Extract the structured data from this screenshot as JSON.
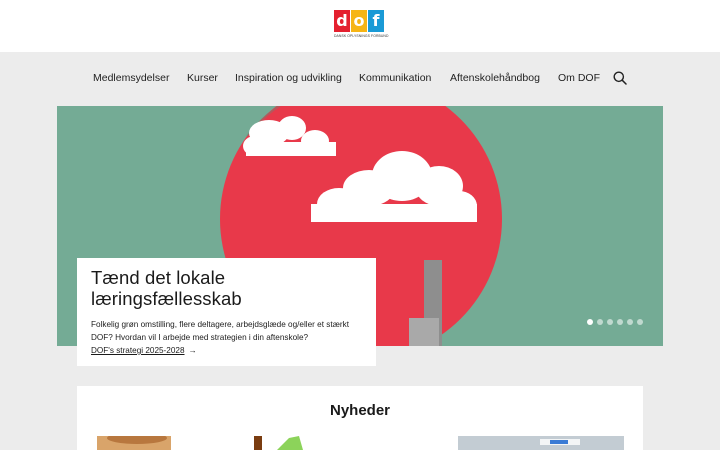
{
  "logo": {
    "letters": [
      "d",
      "o",
      "f"
    ],
    "letter_colors": [
      "#e4202f",
      "#f6b515",
      "#1a9ad6"
    ],
    "tagline": "DANSK OPLYSNINGS FORBUND"
  },
  "nav": {
    "items": [
      "Medlemsydelser",
      "Kurser",
      "Inspiration og udvikling",
      "Kommunikation",
      "Aftenskolehåndbog",
      "Om DOF"
    ],
    "search_icon": "search-icon"
  },
  "hero": {
    "title": "Tænd det lokale læringsfællesskab",
    "text": "Folkelig grøn omstilling, flere deltagere, arbejdsglæde og/eller et stærkt DOF? Hvordan vil I arbejde med strategien i din aftenskole?",
    "link": "DOF's strategi 2025-2028",
    "link_icon": "arrow-right-icon",
    "slides": 6,
    "active_slide": 1,
    "colors": {
      "background": "#74ab95",
      "circle": "#e8394a",
      "cloud": "#ffffff"
    }
  },
  "news": {
    "title": "Nyheder"
  }
}
